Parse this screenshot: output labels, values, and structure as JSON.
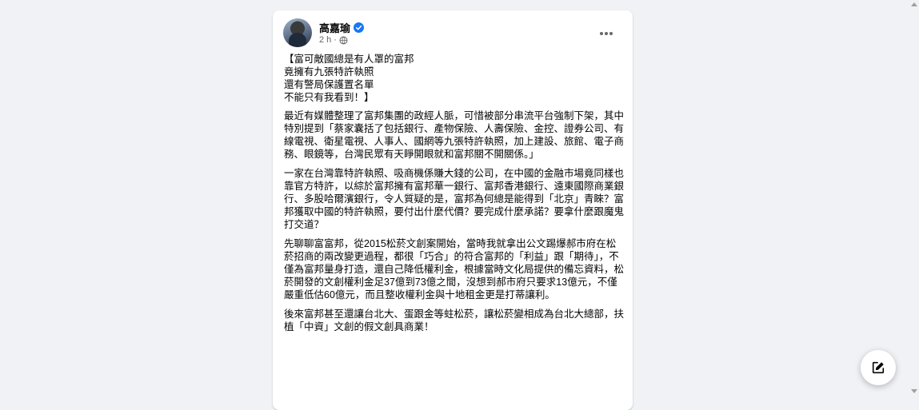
{
  "post": {
    "author": "高嘉瑜",
    "time": "2 h",
    "separator": "·",
    "verified_icon": "verified-badge-icon",
    "privacy_icon": "globe-icon",
    "more_icon": "more-options-icon",
    "headline": [
      "【富可敵國總是有人罩的富邦",
      "竟擁有九張特許執照",
      "還有警局保護置名單",
      "不能只有我看到！】"
    ],
    "paragraphs": [
      "最近有媒體整理了富邦集團的政經人脈，可惜被部分串流平台強制下架，其中特別提到「蔡家囊括了包括銀行、產物保險、人壽保險、金控、證券公司、有線電視、衛星電視、人事人、國網等九張特許執照，加上建設、旅館、電子商務、眼鏡等，台灣民眾有天睜開眼就和富邦關不開關係。」",
      "一家在台灣靠特許執照、吸商機係賺大錢的公司，在中國的金融市場竟同樣也靠官方特許，以綜於富邦擁有富邦華一銀行、富邦香港銀行、遠東國際商業銀行、多股哈爾濱銀行，令人質疑的是，富邦為何總是能得到「北京」青睞？富邦獲取中國的特許執照，要付出什麼代價？要完成什麼承諾？要拿什麼跟魔鬼打交道？",
      "先聊聊富富邦，從2015松菸文創案開始，當時我就拿出公文踢爆郝市府在松菸招商的兩改變更過程，都很「巧合」的符合富邦的「利益」跟「期待」，不僅為富邦量身打造，還自己降低權利金，根據當時文化局提供的備忘資料，松菸開發的文創權利金足37億到73億之間，沒想到郝市府只要求13億元，不僅嚴重低估60億元，而且整收權利金與十地租金更是打蒂讓利。",
      "後來富邦甚至還讓台北大、蛋跟金等蛀松菸，讓松菸變相成為台北大總部，扶植「中資」文創的假文創具商業！"
    ]
  },
  "compose": {
    "icon": "compose-edit-icon"
  },
  "colors": {
    "page_background": "#f0f2f5",
    "card_background": "#ffffff",
    "verified_blue": "#1877f2",
    "secondary_text": "#65676b"
  }
}
